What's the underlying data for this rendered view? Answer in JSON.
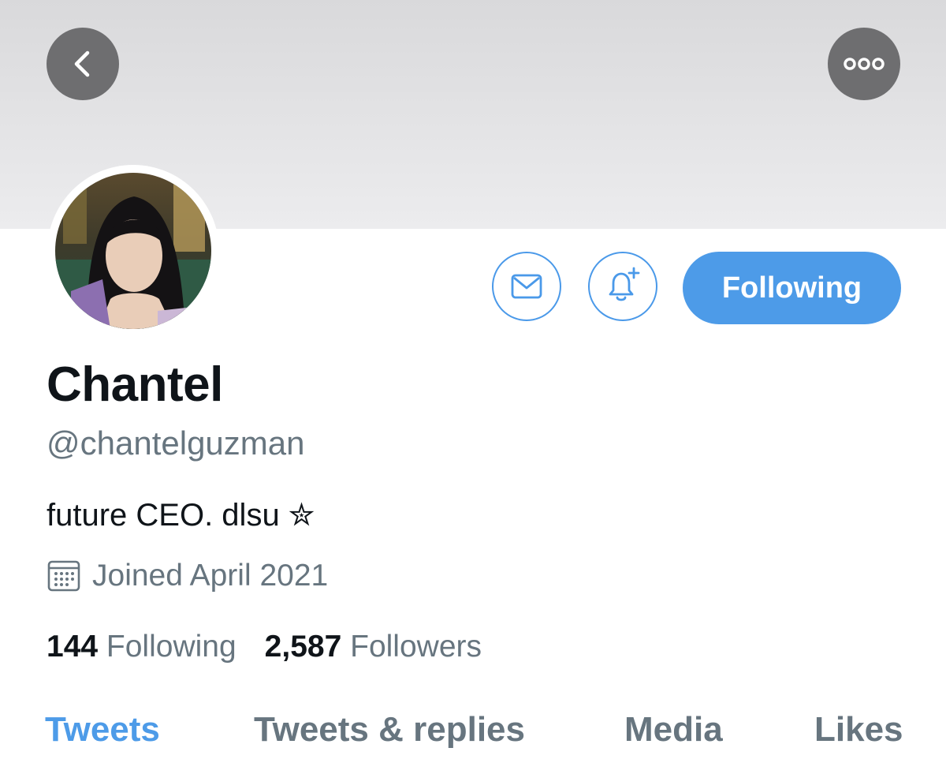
{
  "profile": {
    "display_name": "Chantel",
    "handle": "@chantelguzman",
    "bio": "future CEO. dlsu ✮",
    "joined": "Joined April 2021"
  },
  "actions": {
    "following_label": "Following"
  },
  "stats": {
    "following_count": "144",
    "following_label": "Following",
    "followers_count": "2,587",
    "followers_label": "Followers"
  },
  "tabs": [
    {
      "label": "Tweets",
      "active": true
    },
    {
      "label": "Tweets & replies",
      "active": false
    },
    {
      "label": "Media",
      "active": false
    },
    {
      "label": "Likes",
      "active": false
    }
  ],
  "icons": {
    "back": "chevron-left-icon",
    "more": "more-dots-icon",
    "message": "envelope-icon",
    "notify": "bell-plus-icon",
    "joined": "calendar-icon"
  },
  "colors": {
    "accent": "#4d9be8",
    "text_primary": "#0f1419",
    "text_secondary": "#67757f",
    "overlay_button": "#6e6e70"
  }
}
